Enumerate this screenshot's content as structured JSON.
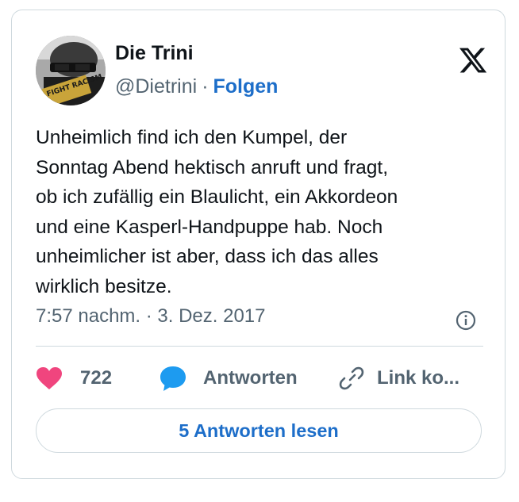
{
  "author": {
    "name": "Die Trini",
    "handle": "@Dietrini",
    "separator": "·",
    "follow_label": "Folgen",
    "avatar_text": "FIGHT RACISM"
  },
  "tweet": {
    "lines": [
      "Unheimlich find ich den Kumpel, der",
      "Sonntag Abend hektisch anruft und fragt,",
      "ob ich zufällig ein Blaulicht, ein Akkordeon",
      "und eine Kasperl-Handpuppe hab. Noch",
      "unheimlicher ist aber, dass ich das alles",
      "wirklich besitze."
    ],
    "timestamp": "7:57 nachm. · 3. Dez. 2017"
  },
  "actions": {
    "like_count": "722",
    "reply_label": "Antworten",
    "link_label": "Link ko..."
  },
  "read_replies_label": "5 Antworten lesen",
  "icons": {
    "logo": "x-logo-icon",
    "info": "info-icon",
    "like": "heart-icon",
    "reply": "speech-bubble-icon",
    "link": "link-icon"
  },
  "colors": {
    "accent": "#1d6ec9",
    "like": "#f0457e",
    "reply": "#1d9bf0",
    "muted": "#536471",
    "border": "#cfd9de"
  }
}
